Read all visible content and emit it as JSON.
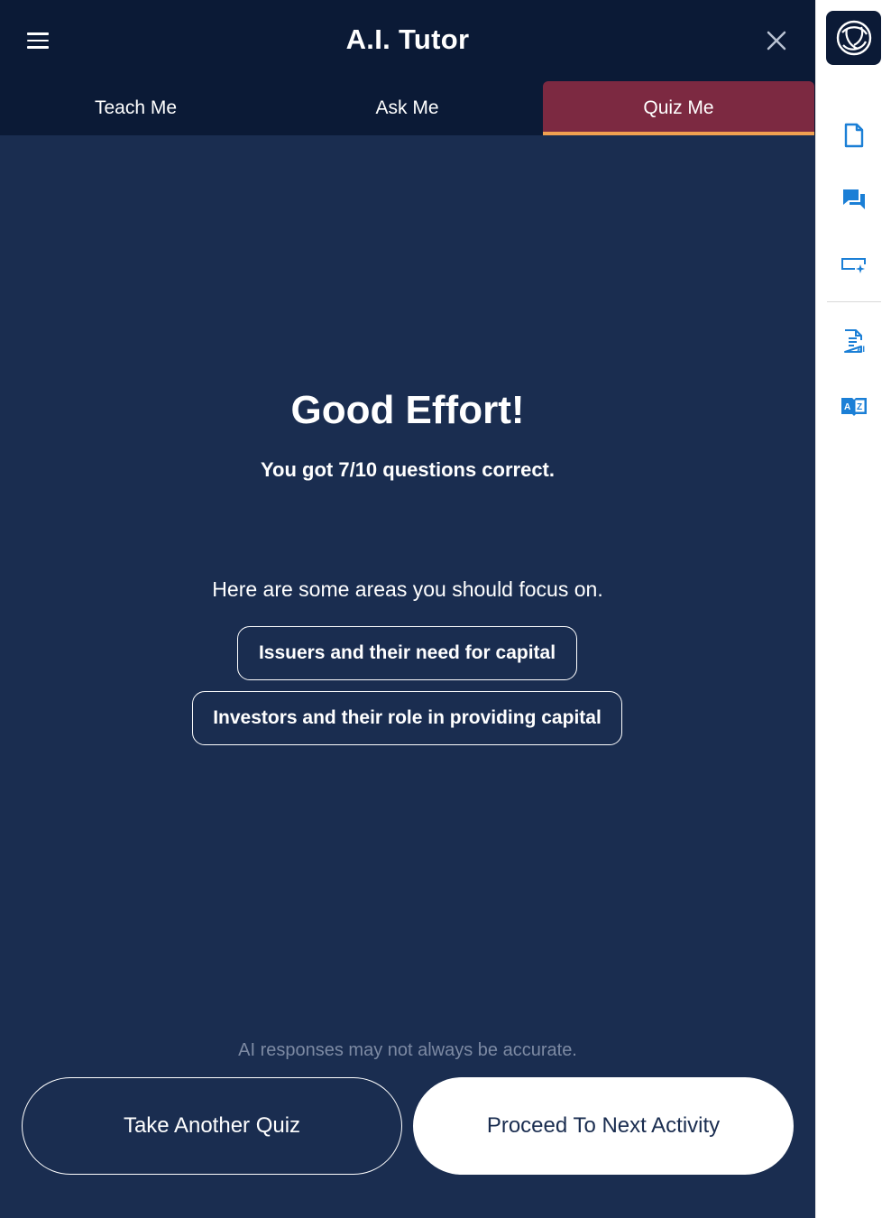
{
  "header": {
    "title": "A.I. Tutor"
  },
  "tabs": [
    {
      "label": "Teach Me",
      "active": false
    },
    {
      "label": "Ask Me",
      "active": false
    },
    {
      "label": "Quiz Me",
      "active": true
    }
  ],
  "result": {
    "title": "Good Effort!",
    "summary": "You got 7/10 questions correct.",
    "focus_intro": "Here are some areas you should focus on.",
    "focus_areas": [
      "Issuers and their need for capital",
      "Investors and their role in providing capital"
    ]
  },
  "footer": {
    "disclaimer": "AI responses may not always be accurate.",
    "take_another_label": "Take Another Quiz",
    "proceed_label": "Proceed To Next Activity"
  },
  "sidebar": {
    "icons": [
      "document-icon",
      "chat-icon",
      "screen-ai-icon",
      "ai-document-icon",
      "dictionary-icon"
    ]
  },
  "colors": {
    "panel_bg": "#1a2d50",
    "header_bg": "#0b1a36",
    "active_tab_bg": "#7c2941",
    "active_tab_underline": "#f0a050",
    "sidebar_icon": "#1b7fd6"
  }
}
